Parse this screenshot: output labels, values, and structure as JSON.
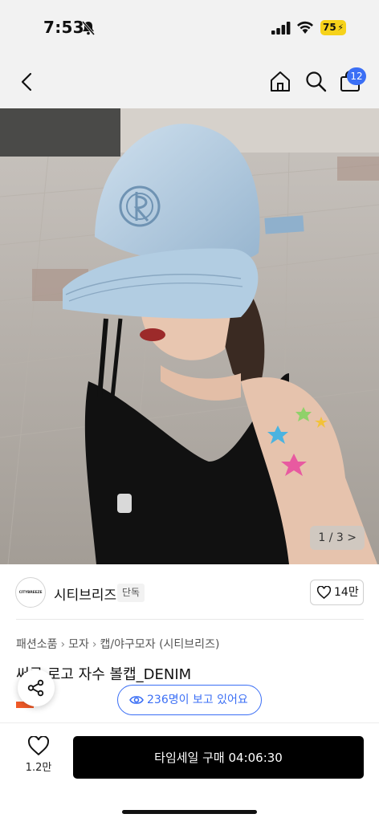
{
  "status_bar": {
    "time": "7:53",
    "battery": "75"
  },
  "nav": {
    "cart_count": "12"
  },
  "gallery": {
    "page_indicator": "1 / 3"
  },
  "seller": {
    "logo_text": "CITYBREEZE",
    "name": "시티브리즈",
    "badge": "단독",
    "like_count": "14만"
  },
  "breadcrumb": {
    "items": [
      "패션소품",
      "모자",
      "캡/야구모자 (시티브리즈)"
    ]
  },
  "product": {
    "title": "써클 로고 자수 볼캡_DENIM"
  },
  "viewers": {
    "label": "236명이 보고 있어요"
  },
  "bottom": {
    "wish_count": "1.2만",
    "buy_label": "타임세일 구매 04:06:30"
  },
  "icons": {
    "back": "chevron-left-icon",
    "home": "home-icon",
    "search": "search-icon",
    "cart": "shopping-bag-icon",
    "share": "share-icon",
    "heart": "heart-icon",
    "eye": "eye-icon"
  },
  "colors": {
    "accent": "#3b6ff5",
    "buy_button": "#000000",
    "battery": "#f6d21a"
  }
}
